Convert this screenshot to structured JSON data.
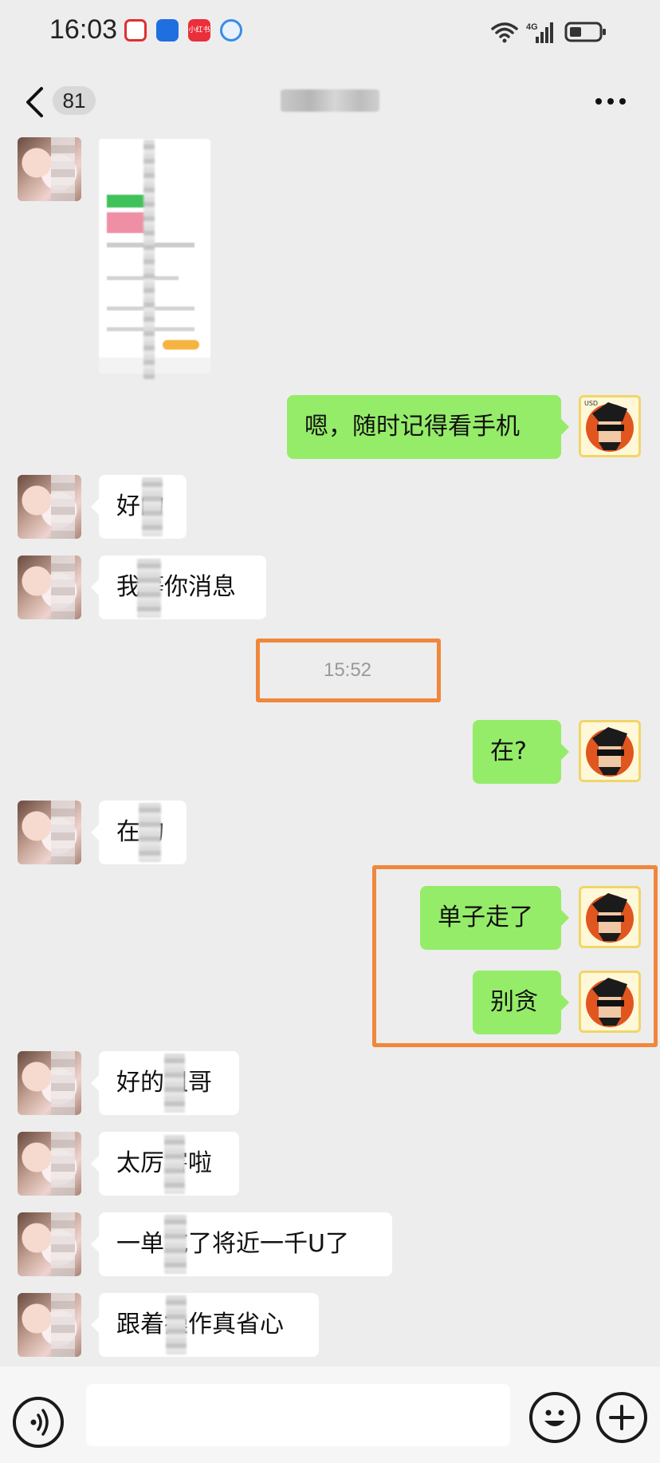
{
  "status_bar": {
    "time": "16:03",
    "network": "4G",
    "app_badge_text": "小红书"
  },
  "nav": {
    "unread_count": "81"
  },
  "messages": [
    {
      "side": "right",
      "text": "嗯，随时记得看手机"
    },
    {
      "side": "left",
      "text": "好的"
    },
    {
      "side": "left",
      "text": "我等你消息"
    },
    {
      "side": "right",
      "text": "在?"
    },
    {
      "side": "left",
      "text": "在的"
    },
    {
      "side": "right",
      "text": "单子走了"
    },
    {
      "side": "right",
      "text": "别贪"
    },
    {
      "side": "left",
      "text": "好的姐哥"
    },
    {
      "side": "left",
      "text": "太厉害啦"
    },
    {
      "side": "left",
      "text": "一单吃了将近一千U了"
    },
    {
      "side": "left",
      "text": "跟着操作真省心"
    }
  ],
  "timestamp": "15:52",
  "avatar_badge": "USD",
  "colors": {
    "background": "#ededed",
    "sent_bubble": "#95ec69",
    "received_bubble": "#ffffff",
    "highlight": "#f0873c"
  },
  "icons": {
    "back": "chevron-left-icon",
    "more": "more-dots-icon",
    "voice": "voice-icon",
    "emoji": "emoji-icon",
    "plus": "plus-icon"
  }
}
